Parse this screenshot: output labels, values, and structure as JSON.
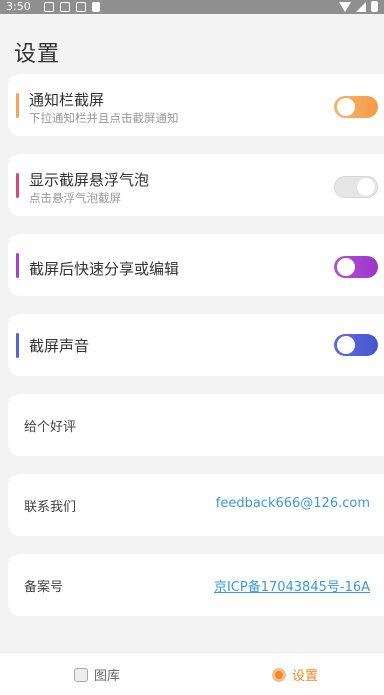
{
  "status_bar": {
    "time": "3:50"
  },
  "page": {
    "title": "设置"
  },
  "settings": [
    {
      "title": "通知栏截屏",
      "subtitle": "下拉通知栏并且点击截屏通知",
      "toggle_on": true,
      "accent": "#f7a35a"
    },
    {
      "title": "显示截屏悬浮气泡",
      "subtitle": "点击悬浮气泡截屏",
      "toggle_on": false,
      "accent": "#e0457a"
    },
    {
      "title": "截屏后快速分享或编辑",
      "subtitle": "",
      "toggle_on": true,
      "accent": "#a83fcf"
    },
    {
      "title": "截屏声音",
      "subtitle": "",
      "toggle_on": true,
      "accent": "#5563d8"
    }
  ],
  "links": {
    "review": {
      "label": "给个好评"
    },
    "contact": {
      "label": "联系我们",
      "value": "feedback666@126.com"
    },
    "record": {
      "label": "备案号",
      "value": "京ICP备17043845号-16A"
    }
  },
  "bottom_nav": {
    "gallery": {
      "label": "图库",
      "icon": "gallery-icon"
    },
    "settings": {
      "label": "设置",
      "icon": "settings-icon",
      "active": true,
      "color": "#f08a2c"
    }
  }
}
